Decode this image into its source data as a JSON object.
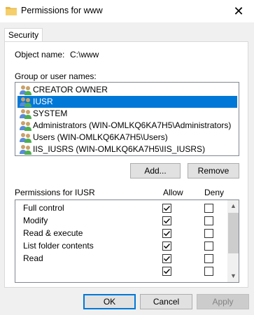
{
  "window": {
    "title": "Permissions for www"
  },
  "tabs": [
    {
      "label": "Security"
    }
  ],
  "object_name": {
    "label": "Object name:",
    "value": "C:\\www"
  },
  "group_list": {
    "label": "Group or user names:",
    "items": [
      {
        "name": "CREATOR OWNER",
        "selected": false
      },
      {
        "name": "IUSR",
        "selected": true
      },
      {
        "name": "SYSTEM",
        "selected": false
      },
      {
        "name": "Administrators (WIN-OMLKQ6KA7H5\\Administrators)",
        "selected": false
      },
      {
        "name": "Users (WIN-OMLKQ6KA7H5\\Users)",
        "selected": false
      },
      {
        "name": "IIS_IUSRS (WIN-OMLKQ6KA7H5\\IIS_IUSRS)",
        "selected": false
      }
    ]
  },
  "buttons": {
    "add": "Add...",
    "remove": "Remove",
    "ok": "OK",
    "cancel": "Cancel",
    "apply": "Apply"
  },
  "permissions": {
    "label": "Permissions for IUSR",
    "allow_header": "Allow",
    "deny_header": "Deny",
    "rows": [
      {
        "name": "Full control",
        "allow": true,
        "deny": false
      },
      {
        "name": "Modify",
        "allow": true,
        "deny": false
      },
      {
        "name": "Read & execute",
        "allow": true,
        "deny": false
      },
      {
        "name": "List folder contents",
        "allow": true,
        "deny": false
      },
      {
        "name": "Read",
        "allow": true,
        "deny": false
      },
      {
        "name": "",
        "allow": true,
        "deny": false
      }
    ]
  },
  "colors": {
    "selection": "#0078d7",
    "accent": "#0078d7"
  },
  "icons": {
    "window": "folder-icon",
    "user": "users-icon",
    "close": "close-icon",
    "check": "check-icon"
  }
}
